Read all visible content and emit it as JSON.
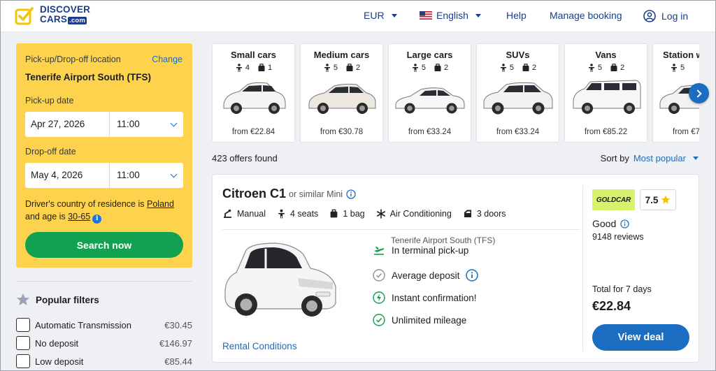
{
  "header": {
    "logo_line1": "DISCOVER",
    "logo_line2": "CARS",
    "logo_com": ".com",
    "currency": "EUR",
    "language": "English",
    "help": "Help",
    "manage_booking": "Manage booking",
    "login": "Log in"
  },
  "search": {
    "location_label": "Pick-up/Drop-off location",
    "change": "Change",
    "location_value": "Tenerife Airport South (TFS)",
    "pickup_label": "Pick-up date",
    "pickup_date": "Apr 27, 2026",
    "pickup_time": "11:00",
    "dropoff_label": "Drop-off date",
    "dropoff_date": "May 4, 2026",
    "dropoff_time": "11:00",
    "residence_prefix": "Driver's country of residence is",
    "residence_country": "Poland",
    "age_prefix": "and age is",
    "age_range": "30-65",
    "search_button": "Search now"
  },
  "filters": {
    "title": "Popular filters",
    "items": [
      {
        "label": "Automatic Transmission",
        "price": "€30.45"
      },
      {
        "label": "No deposit",
        "price": "€146.97"
      },
      {
        "label": "Low deposit",
        "price": "€85.44"
      }
    ]
  },
  "categories": [
    {
      "name": "Small cars",
      "seats": "4",
      "bags": "1",
      "price": "from €22.84"
    },
    {
      "name": "Medium cars",
      "seats": "5",
      "bags": "2",
      "price": "from €30.78"
    },
    {
      "name": "Large cars",
      "seats": "5",
      "bags": "2",
      "price": "from €33.24"
    },
    {
      "name": "SUVs",
      "seats": "5",
      "bags": "2",
      "price": "from €33.24"
    },
    {
      "name": "Vans",
      "seats": "5",
      "bags": "2",
      "price": "from €85.22"
    },
    {
      "name": "Station w",
      "seats": "5",
      "bags": "",
      "price": "from €7"
    }
  ],
  "results": {
    "offers_found": "423 offers found",
    "sort_label": "Sort by",
    "sort_value": "Most popular"
  },
  "offer": {
    "car_name": "Citroen C1",
    "similar": "or similar Mini",
    "specs": {
      "transmission": "Manual",
      "seats": "4 seats",
      "bags": "1 bag",
      "ac": "Air Conditioning",
      "doors": "3 doors"
    },
    "pickup_location": "Tenerife Airport South (TFS)",
    "features": {
      "pickup": "In terminal pick-up",
      "deposit": "Average deposit",
      "confirmation": "Instant confirmation!",
      "mileage": "Unlimited mileage"
    },
    "rental_conditions": "Rental Conditions",
    "supplier": "GOLDCAR",
    "rating": "7.5",
    "rating_text": "Good",
    "reviews": "9148 reviews",
    "total_label": "Total for 7 days",
    "total_price": "€22.84",
    "view_deal": "View deal"
  },
  "colors": {
    "brand_blue": "#1a3e8c",
    "link_blue": "#1a6dc0",
    "search_yellow": "#fdd34d",
    "search_green": "#12a150",
    "supplier_lime": "#d9f26e"
  }
}
